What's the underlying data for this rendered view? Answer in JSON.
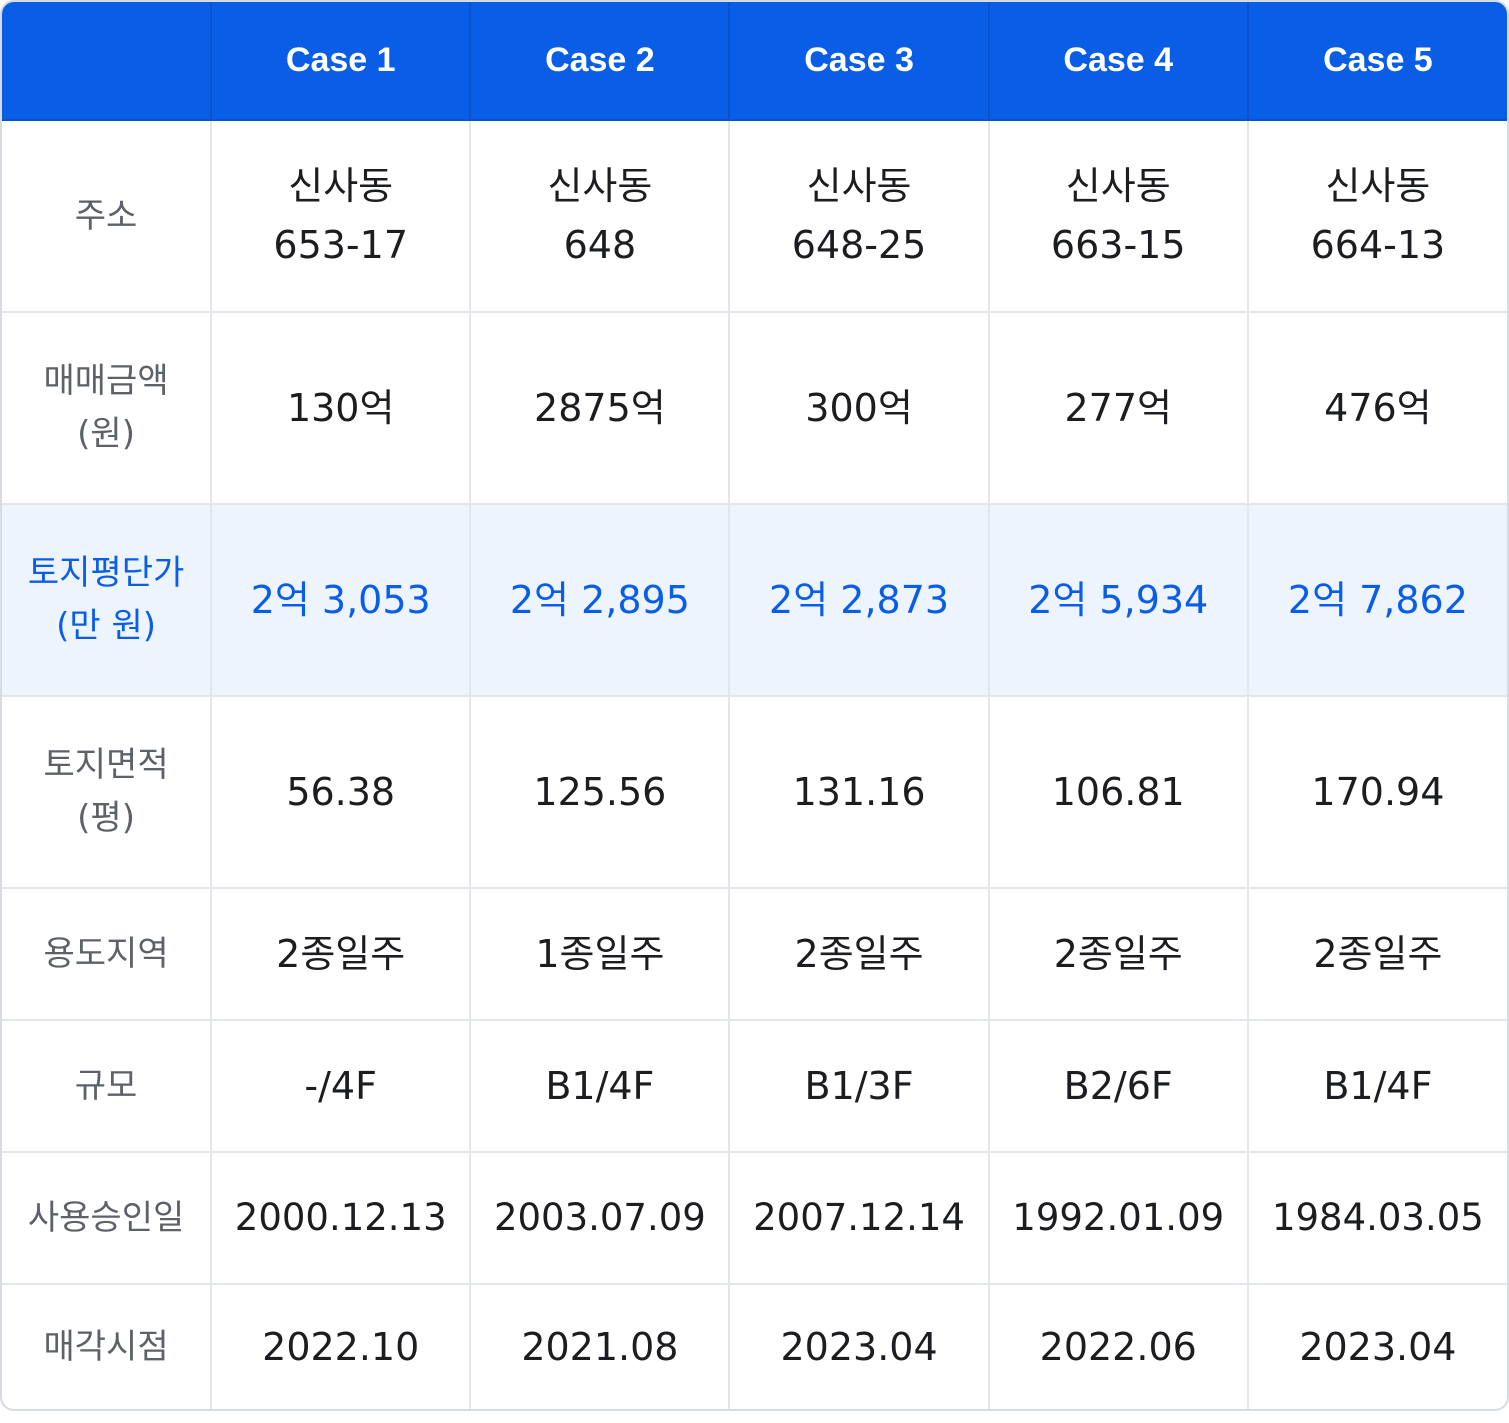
{
  "header": {
    "corner": "",
    "cases": [
      "Case 1",
      "Case 2",
      "Case 3",
      "Case 4",
      "Case 5"
    ]
  },
  "rows": {
    "address": {
      "label": "주소",
      "values": [
        {
          "line1": "신사동",
          "line2": "653-17"
        },
        {
          "line1": "신사동",
          "line2": "648"
        },
        {
          "line1": "신사동",
          "line2": "648-25"
        },
        {
          "line1": "신사동",
          "line2": "663-15"
        },
        {
          "line1": "신사동",
          "line2": "664-13"
        }
      ]
    },
    "sale_price": {
      "label_line1": "매매금액",
      "label_line2": "(원)",
      "values": [
        "130억",
        "2875억",
        "300억",
        "277억",
        "476억"
      ]
    },
    "land_unit_price": {
      "label_line1": "토지평단가",
      "label_line2": "(만 원)",
      "values": [
        "2억 3,053",
        "2억 2,895",
        "2억 2,873",
        "2억 5,934",
        "2억 7,862"
      ],
      "highlight": true,
      "highlight_text_color": "#0a5ee6",
      "highlight_bg_color": "#edf4fe"
    },
    "land_area": {
      "label_line1": "토지면적",
      "label_line2": "(평)",
      "values": [
        "56.38",
        "125.56",
        "131.16",
        "106.81",
        "170.94"
      ]
    },
    "zoning": {
      "label": "용도지역",
      "values": [
        "2종일주",
        "1종일주",
        "2종일주",
        "2종일주",
        "2종일주"
      ]
    },
    "scale": {
      "label": "규모",
      "values": [
        "-/4F",
        "B1/4F",
        "B1/3F",
        "B2/6F",
        "B1/4F"
      ]
    },
    "approval_date": {
      "label": "사용승인일",
      "values": [
        "2000.12.13",
        "2003.07.09",
        "2007.12.14",
        "1992.01.09",
        "1984.03.05"
      ]
    },
    "sale_time": {
      "label": "매각시점",
      "values": [
        "2022.10",
        "2021.08",
        "2023.04",
        "2022.06",
        "2023.04"
      ]
    }
  },
  "colors": {
    "header_bg": "#0a5ee6",
    "header_text": "#ffffff",
    "label_text": "#5d6168",
    "value_text": "#1b1d21",
    "grid": "#e3e6ea"
  }
}
